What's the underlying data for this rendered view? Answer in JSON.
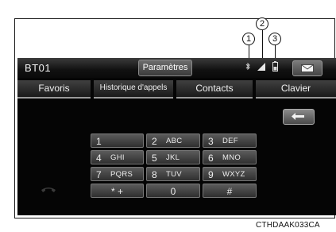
{
  "header": {
    "device_name": "BT01",
    "settings_label": "Paramètres"
  },
  "status_icons": [
    "bluetooth-icon",
    "signal-strength-icon",
    "battery-icon"
  ],
  "tabs": [
    {
      "label": "Favoris"
    },
    {
      "label": "Historique d'appels"
    },
    {
      "label": "Contacts"
    },
    {
      "label": "Clavier"
    }
  ],
  "keypad": [
    {
      "digit": "1",
      "letters": ""
    },
    {
      "digit": "2",
      "letters": "ABC"
    },
    {
      "digit": "3",
      "letters": "DEF"
    },
    {
      "digit": "4",
      "letters": "GHI"
    },
    {
      "digit": "5",
      "letters": "JKL"
    },
    {
      "digit": "6",
      "letters": "MNO"
    },
    {
      "digit": "7",
      "letters": "PQRS"
    },
    {
      "digit": "8",
      "letters": "TUV"
    },
    {
      "digit": "9",
      "letters": "WXYZ"
    },
    {
      "digit": "* +",
      "letters": ""
    },
    {
      "digit": "0",
      "letters": ""
    },
    {
      "digit": "#",
      "letters": ""
    }
  ],
  "callouts": [
    "1",
    "2",
    "3"
  ],
  "caption": "CTHDAAK033CA"
}
